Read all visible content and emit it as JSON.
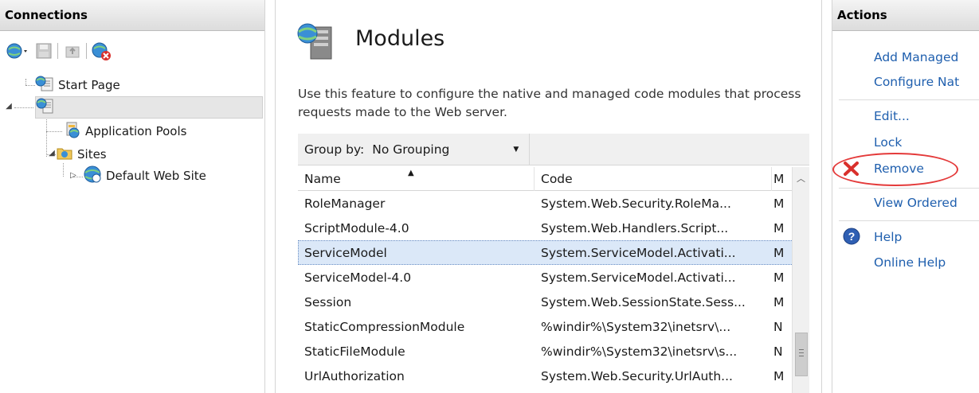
{
  "connections": {
    "title": "Connections",
    "toolbar": {
      "icons": [
        "globe-connect-icon",
        "save-icon",
        "up-folder-icon",
        "disconnect-icon"
      ]
    },
    "tree": {
      "start_page": "Start Page",
      "server": "",
      "app_pools": "Application Pools",
      "sites": "Sites",
      "default_site": "Default Web Site"
    }
  },
  "main": {
    "title": "Modules",
    "description": "Use this feature to configure the native and managed code modules that process requests made to the Web server.",
    "group_by_label": "Group by:",
    "group_by_value": "No Grouping",
    "columns": [
      "Name",
      "Code",
      "M"
    ],
    "rows": [
      {
        "name": "RoleManager",
        "code": "System.Web.Security.RoleMa...",
        "m": "M"
      },
      {
        "name": "ScriptModule-4.0",
        "code": "System.Web.Handlers.Script...",
        "m": "M"
      },
      {
        "name": "ServiceModel",
        "code": "System.ServiceModel.Activati...",
        "m": "M"
      },
      {
        "name": "ServiceModel-4.0",
        "code": "System.ServiceModel.Activati...",
        "m": "M"
      },
      {
        "name": "Session",
        "code": "System.Web.SessionState.Sess...",
        "m": "M"
      },
      {
        "name": "StaticCompressionModule",
        "code": "%windir%\\System32\\inetsrv\\...",
        "m": "N"
      },
      {
        "name": "StaticFileModule",
        "code": "%windir%\\System32\\inetsrv\\s...",
        "m": "N"
      },
      {
        "name": "UrlAuthorization",
        "code": "System.Web.Security.UrlAuth...",
        "m": "M"
      }
    ],
    "selected_row": 2
  },
  "actions": {
    "title": "Actions",
    "add_managed": "Add Managed",
    "configure_native": "Configure Nat",
    "edit": "Edit...",
    "lock": "Lock",
    "remove": "Remove",
    "view_ordered": "View Ordered",
    "help": "Help",
    "online_help": "Online Help"
  },
  "colors": {
    "link": "#1f5fae",
    "selected_row": "#dbe8f8",
    "highlight": "#e43a3a",
    "remove_icon": "#d9302c"
  }
}
